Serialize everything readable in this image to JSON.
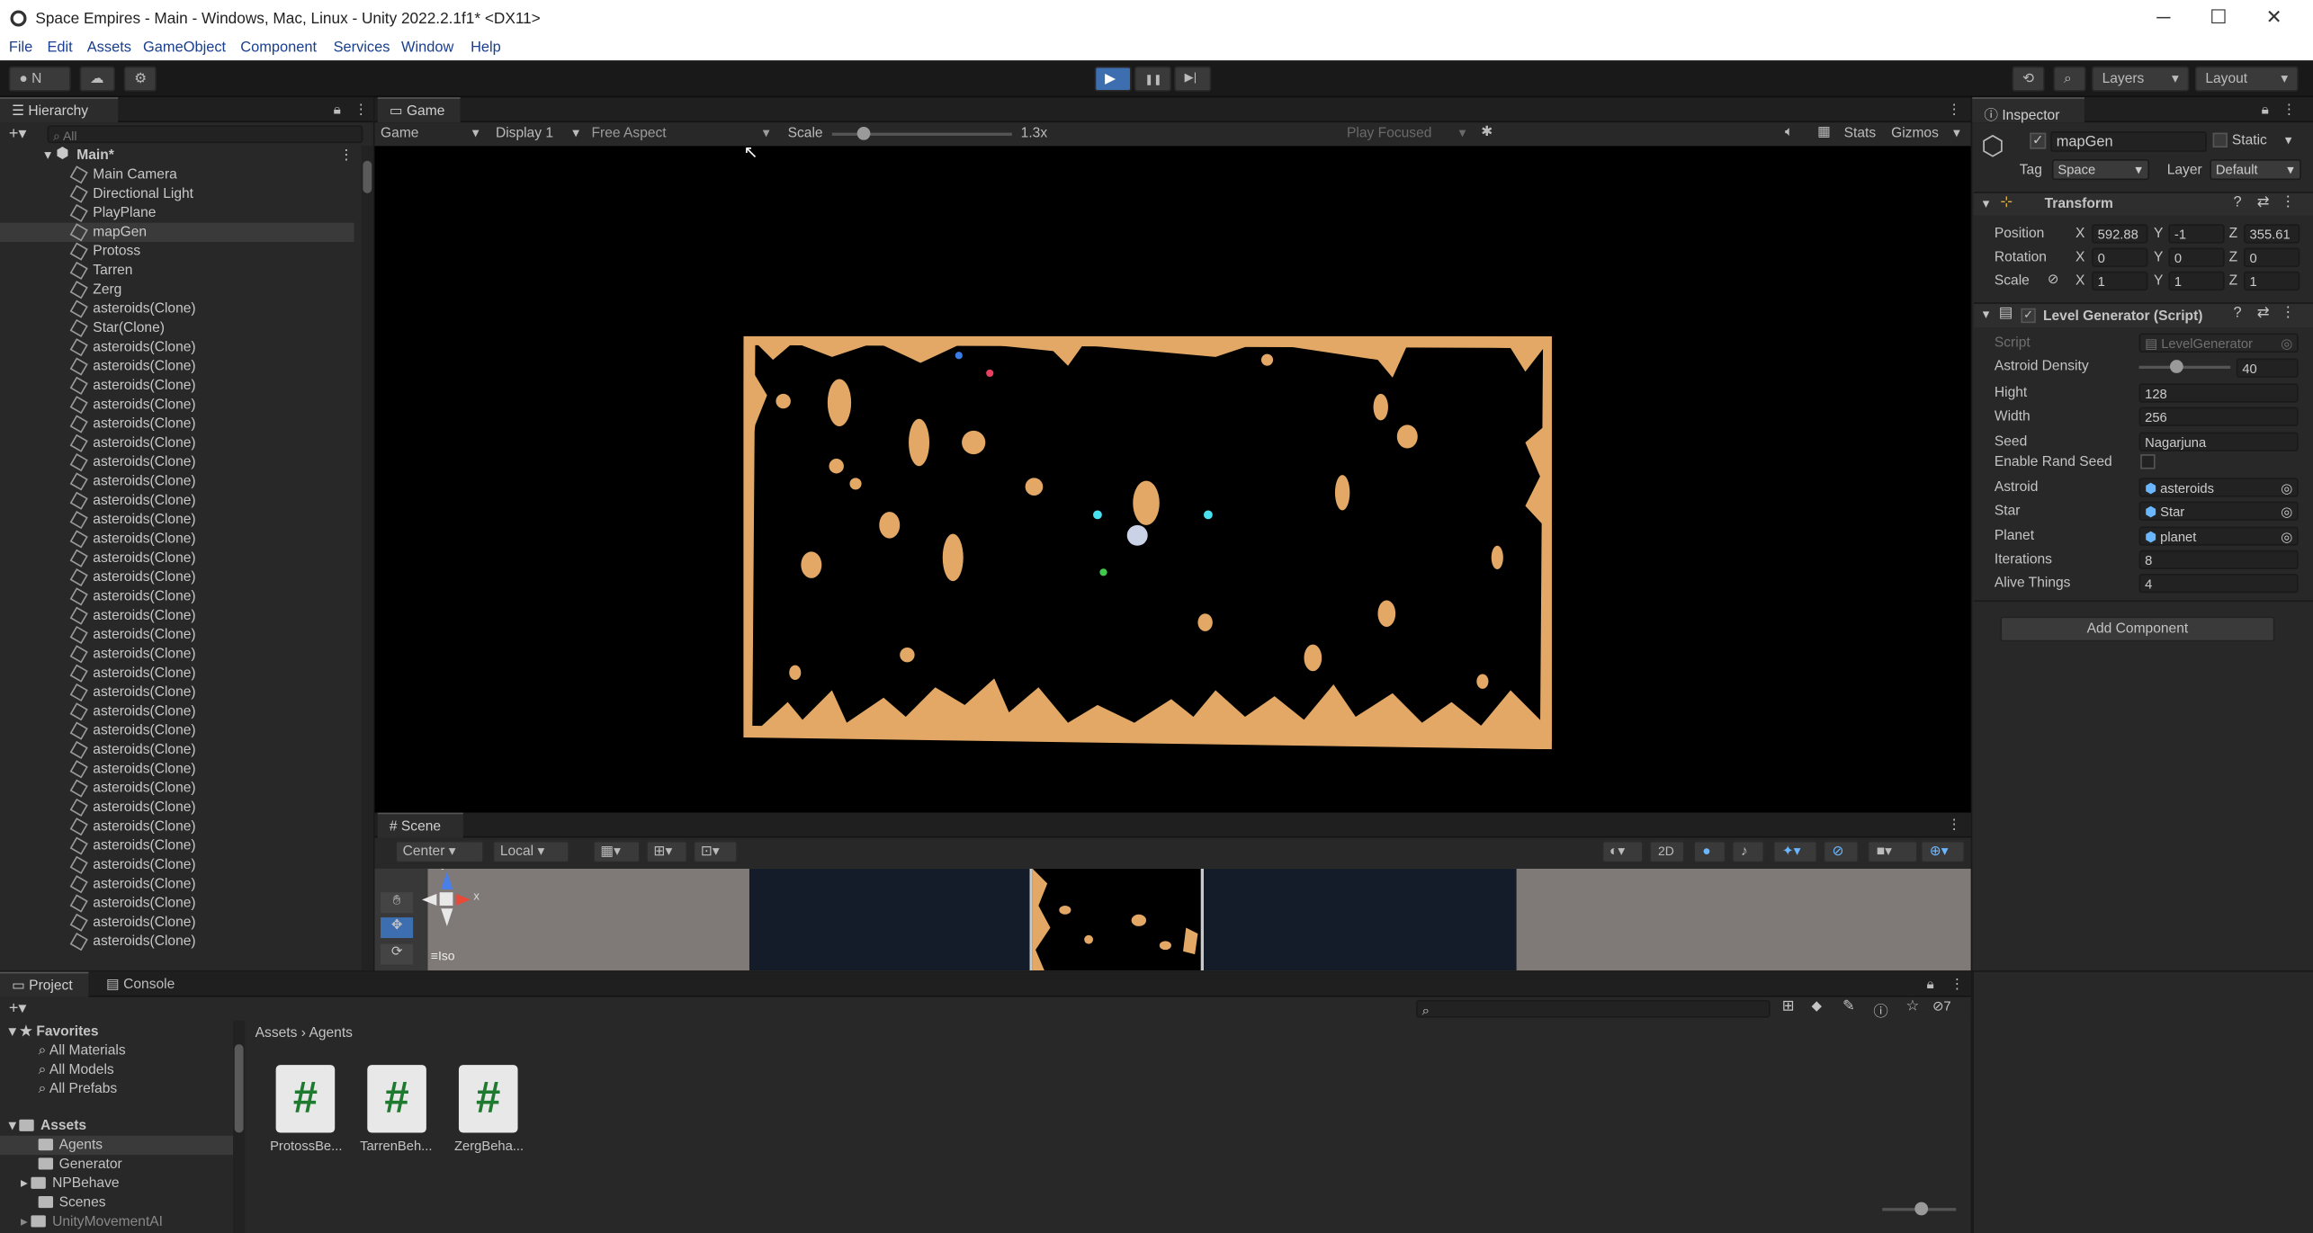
{
  "window": {
    "title": "Space Empires - Main - Windows, Mac, Linux - Unity 2022.2.1f1* <DX11>",
    "minimize": "─",
    "maximize": "☐",
    "close": "✕"
  },
  "menu": [
    "File",
    "Edit",
    "Assets",
    "GameObject",
    "Component",
    "Services",
    "Window",
    "Help"
  ],
  "toolbar": {
    "account": "N",
    "play": "▶",
    "pause": "❚❚",
    "step": "▶|",
    "layers": "Layers",
    "layout": "Layout"
  },
  "hierarchy": {
    "tab": "Hierarchy",
    "search_placeholder": "All",
    "root": "Main*",
    "items": [
      "Main Camera",
      "Directional Light",
      "PlayPlane",
      "mapGen",
      "Protoss",
      "Tarren",
      "Zerg",
      "asteroids(Clone)",
      "Star(Clone)",
      "asteroids(Clone)",
      "asteroids(Clone)",
      "asteroids(Clone)",
      "asteroids(Clone)",
      "asteroids(Clone)",
      "asteroids(Clone)",
      "asteroids(Clone)",
      "asteroids(Clone)",
      "asteroids(Clone)",
      "asteroids(Clone)",
      "asteroids(Clone)",
      "asteroids(Clone)",
      "asteroids(Clone)",
      "asteroids(Clone)",
      "asteroids(Clone)",
      "asteroids(Clone)",
      "asteroids(Clone)",
      "asteroids(Clone)",
      "asteroids(Clone)",
      "asteroids(Clone)",
      "asteroids(Clone)",
      "asteroids(Clone)",
      "asteroids(Clone)",
      "asteroids(Clone)",
      "asteroids(Clone)",
      "asteroids(Clone)",
      "asteroids(Clone)",
      "asteroids(Clone)",
      "asteroids(Clone)",
      "asteroids(Clone)",
      "asteroids(Clone)",
      "asteroids(Clone)"
    ],
    "selected": "mapGen"
  },
  "game": {
    "tab": "Game",
    "mode": "Game",
    "display": "Display 1",
    "aspect": "Free Aspect",
    "scale_label": "Scale",
    "scale_value": "1.3x",
    "scale_level": 0.17,
    "play_focused": "Play Focused",
    "stats": "Stats",
    "gizmos": "Gizmos"
  },
  "scene": {
    "tab": "Scene",
    "pivot": "Center",
    "space": "Local",
    "mode2d": "2D",
    "iso": "Iso",
    "axis_x": "x",
    "axis_y": "y"
  },
  "inspector": {
    "tab": "Inspector",
    "object_name": "mapGen",
    "static_label": "Static",
    "tag_label": "Tag",
    "tag": "Space",
    "layer_label": "Layer",
    "layer": "Default",
    "transform": {
      "title": "Transform",
      "position_label": "Position",
      "rotation_label": "Rotation",
      "scale_label": "Scale",
      "position": {
        "x": "592.88",
        "y": "-1",
        "z": "355.61"
      },
      "rotation": {
        "x": "0",
        "y": "0",
        "z": "0"
      },
      "scale": {
        "x": "1",
        "y": "1",
        "z": "1"
      },
      "axis_x": "X",
      "axis_y": "Y",
      "axis_z": "Z"
    },
    "script": {
      "title": "Level Generator (Script)",
      "fields": [
        {
          "label": "Script",
          "value": "LevelGenerator"
        },
        {
          "label": "Astroid Density",
          "value": "40"
        },
        {
          "label": "Hight",
          "value": "128"
        },
        {
          "label": "Width",
          "value": "256"
        },
        {
          "label": "Seed",
          "value": "Nagarjuna"
        },
        {
          "label": "Enable Rand Seed",
          "value": ""
        },
        {
          "label": "Astroid",
          "value": "asteroids"
        },
        {
          "label": "Star",
          "value": "Star"
        },
        {
          "label": "Planet",
          "value": "planet"
        },
        {
          "label": "Iterations",
          "value": "8"
        },
        {
          "label": "Alive Things",
          "value": "4"
        }
      ],
      "density_level": 0.4
    },
    "add_component": "Add Component"
  },
  "project": {
    "tab": "Project",
    "console_tab": "Console",
    "favorites": "Favorites",
    "fav_items": [
      "All Materials",
      "All Models",
      "All Prefabs"
    ],
    "assets": "Assets",
    "folders": [
      "Agents",
      "Generator",
      "NPBehave",
      "Scenes",
      "UnityMovementAI"
    ],
    "breadcrumb": [
      "Assets",
      "Agents"
    ],
    "files": [
      "ProtossBe...",
      "TarrenBeh...",
      "ZergBeha..."
    ],
    "hidden_count": "7",
    "file_glyph": "#"
  }
}
